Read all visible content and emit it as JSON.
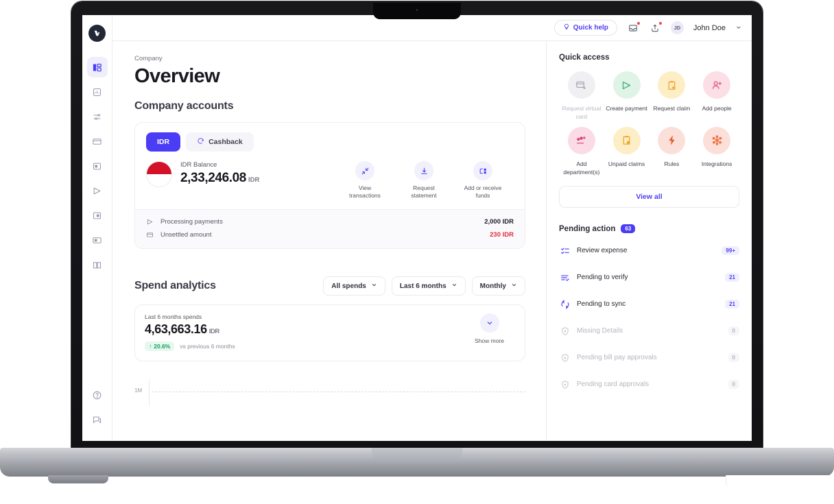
{
  "sidebar": {
    "logo_name": "volopay-logo",
    "items": [
      {
        "name": "dashboard",
        "icon": "dashboard-icon",
        "active": true
      },
      {
        "name": "analytics",
        "icon": "analytics-icon",
        "active": false
      },
      {
        "name": "settings-sliders",
        "icon": "sliders-icon",
        "active": false
      },
      {
        "name": "cards",
        "icon": "card-icon",
        "active": false
      },
      {
        "name": "expenses",
        "icon": "expense-icon",
        "active": false
      },
      {
        "name": "payments",
        "icon": "send-icon",
        "active": false
      },
      {
        "name": "reimbursements",
        "icon": "reimburse-icon",
        "active": false
      },
      {
        "name": "accounting",
        "icon": "accounting-icon",
        "active": false
      },
      {
        "name": "ledger",
        "icon": "book-icon",
        "active": false
      }
    ],
    "bottom_items": [
      {
        "name": "help",
        "icon": "help-circle-icon"
      },
      {
        "name": "chat",
        "icon": "chat-icon"
      }
    ]
  },
  "topbar": {
    "quick_help_label": "Quick help",
    "quick_help_icon": "bulb-icon",
    "inbox_icon": "inbox-icon",
    "share_icon": "share-icon",
    "avatar_initials": "JD",
    "user_name": "John Doe",
    "chevron_icon": "chevron-down-icon"
  },
  "page": {
    "breadcrumb": "Company",
    "title": "Overview",
    "accounts_section_title": "Company accounts"
  },
  "account_card": {
    "tabs": [
      {
        "label": "IDR",
        "active": true,
        "icon": ""
      },
      {
        "label": "Cashback",
        "active": false,
        "icon": "cashback-icon"
      }
    ],
    "flag_icon": "indonesia-flag-icon",
    "balance_label": "IDR Balance",
    "balance_amount": "2,33,246.08",
    "balance_currency": "IDR",
    "actions": [
      {
        "label": "View transactions",
        "icon": "transactions-icon"
      },
      {
        "label": "Request statement",
        "icon": "download-icon"
      },
      {
        "label": "Add or receive funds",
        "icon": "add-funds-icon"
      }
    ],
    "sub_rows": [
      {
        "label": "Processing payments",
        "value": "2,000 IDR",
        "icon": "send-icon",
        "negative": false
      },
      {
        "label": "Unsettled amount",
        "value": "230 IDR",
        "icon": "card-icon",
        "negative": true
      }
    ]
  },
  "spend": {
    "title": "Spend analytics",
    "filters": [
      {
        "label": "All spends",
        "icon": "chevron-down-icon"
      },
      {
        "label": "Last 6 months",
        "icon": "chevron-down-icon"
      },
      {
        "label": "Monthly",
        "icon": "chevron-down-icon"
      }
    ],
    "summary_label": "Last 6 months spends",
    "summary_amount": "4,63,663.16",
    "summary_currency": "IDR",
    "delta_value": "20.6%",
    "delta_arrow": "↑",
    "delta_note": "vs previous 6 months",
    "show_more_label": "Show more",
    "show_more_icon": "chevron-down-icon"
  },
  "chart_data": {
    "type": "bar",
    "title": "Spend analytics",
    "categories": [],
    "values": [],
    "ytick_labels": [
      "1M"
    ],
    "grid": true,
    "xlabel": "",
    "ylabel": ""
  },
  "quick_access": {
    "title": "Quick access",
    "items": [
      {
        "label": "Request virtual card",
        "icon": "virtual-card-icon",
        "bg": "#f0f0f3",
        "fg": "#a8a8b4",
        "disabled": true
      },
      {
        "label": "Create payment",
        "icon": "send-icon",
        "bg": "#dff3e7",
        "fg": "#3fae78",
        "disabled": false
      },
      {
        "label": "Request claim",
        "icon": "clipboard-plus-icon",
        "bg": "#fdeec6",
        "fg": "#f0a428",
        "disabled": false
      },
      {
        "label": "Add people",
        "icon": "user-plus-icon",
        "bg": "#fbdee6",
        "fg": "#e0507c",
        "disabled": false
      },
      {
        "label": "Add department(s)",
        "icon": "department-icon",
        "bg": "#fbdce6",
        "fg": "#d8417a",
        "disabled": false
      },
      {
        "label": "Unpaid claims",
        "icon": "clipboard-alert-icon",
        "bg": "#fdeec6",
        "fg": "#f0a428",
        "disabled": false
      },
      {
        "label": "Rules",
        "icon": "bolt-icon",
        "bg": "#fbe0da",
        "fg": "#ee5a2a",
        "disabled": false
      },
      {
        "label": "Integrations",
        "icon": "integrations-icon",
        "bg": "#fbdfd8",
        "fg": "#ef7044",
        "disabled": false
      }
    ],
    "view_all_label": "View all"
  },
  "pending_action": {
    "title": "Pending action",
    "badge": "63",
    "items": [
      {
        "label": "Review expense",
        "count": "99+",
        "icon": "checklist-icon",
        "disabled": false
      },
      {
        "label": "Pending to verify",
        "count": "21",
        "icon": "list-check-icon",
        "disabled": false
      },
      {
        "label": "Pending to sync",
        "count": "21",
        "icon": "sync-icon",
        "disabled": false
      },
      {
        "label": "Missing Details",
        "count": "0",
        "icon": "shield-icon",
        "disabled": true
      },
      {
        "label": "Pending bill pay approvals",
        "count": "0",
        "icon": "shield-icon",
        "disabled": true
      },
      {
        "label": "Pending card approvals",
        "count": "0",
        "icon": "shield-icon",
        "disabled": true
      }
    ]
  },
  "colors": {
    "accent": "#4b3df5",
    "danger": "#e02d3c",
    "success": "#12a05c",
    "text": "#171720"
  }
}
